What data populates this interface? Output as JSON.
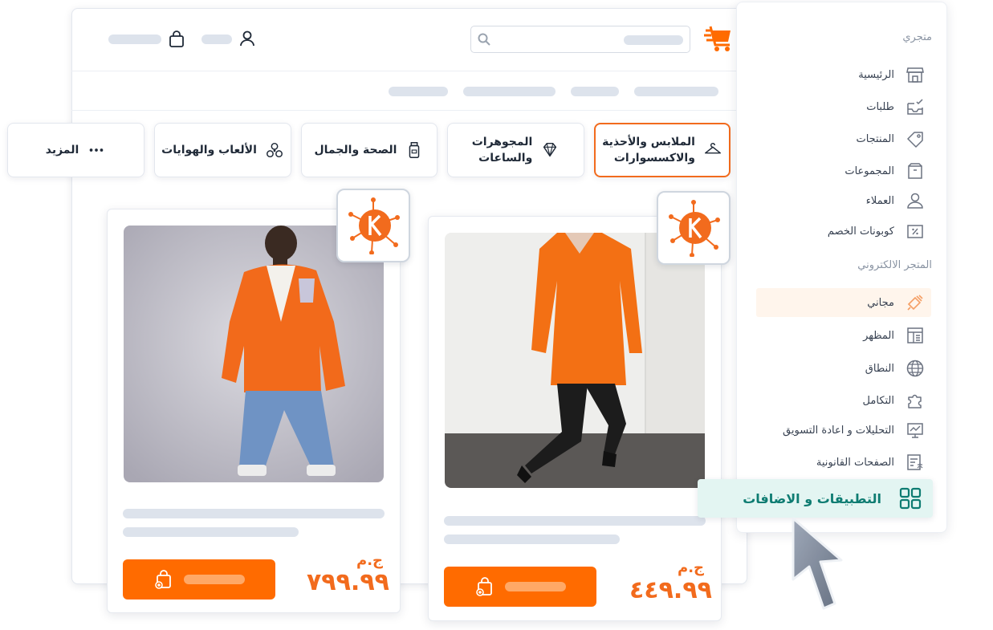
{
  "categories": [
    {
      "label_line1": "الملابس والأحذية",
      "label_line2": "والاكسسوارات",
      "icon": "hanger-icon",
      "active": true
    },
    {
      "label_line1": "المجوهرات",
      "label_line2": "والساعات",
      "icon": "diamond-icon",
      "active": false
    },
    {
      "label_line1": "الصحة والجمال",
      "label_line2": "",
      "icon": "bottle-icon",
      "active": false
    },
    {
      "label_line1": "الألعاب والهوايات",
      "label_line2": "",
      "icon": "toy-icon",
      "active": false
    },
    {
      "label_line1": "المزيد",
      "label_line2": "",
      "icon": "more-dots-icon",
      "active": false
    }
  ],
  "products": [
    {
      "currency": "ج.م",
      "price": "٧٩٩.٩٩"
    },
    {
      "currency": "ج.م",
      "price": "٤٤٩.٩٩"
    }
  ],
  "sidebar": {
    "section_store": "متجري",
    "store_items": [
      {
        "label": "الرئيسية",
        "icon": "storefront-icon"
      },
      {
        "label": "طلبات",
        "icon": "inbox-check-icon"
      },
      {
        "label": "المنتجات",
        "icon": "tag-icon"
      },
      {
        "label": "المجموعات",
        "icon": "box-icon"
      },
      {
        "label": "العملاء",
        "icon": "user-icon"
      },
      {
        "label": "كوبونات الخصم",
        "icon": "percent-icon"
      }
    ],
    "section_online": "المتجر الالكتروني",
    "online_items": [
      {
        "label": "مجاني",
        "icon": "free-tag-icon"
      },
      {
        "label": "المظهر",
        "icon": "layout-icon"
      },
      {
        "label": "النطاق",
        "icon": "globe-icon"
      },
      {
        "label": "التكامل",
        "icon": "puzzle-icon"
      },
      {
        "label": "التحليلات و اعادة التسويق",
        "icon": "analytics-board-icon"
      },
      {
        "label": "الصفحات القانونية",
        "icon": "legal-doc-icon"
      }
    ],
    "apps_label": "التطبيقات و الاضافات"
  },
  "colors": {
    "brand_orange": "#ff6b00",
    "price_orange": "#f26b1d",
    "teal": "#0e7c72",
    "teal_bg": "#e3f5f2"
  }
}
